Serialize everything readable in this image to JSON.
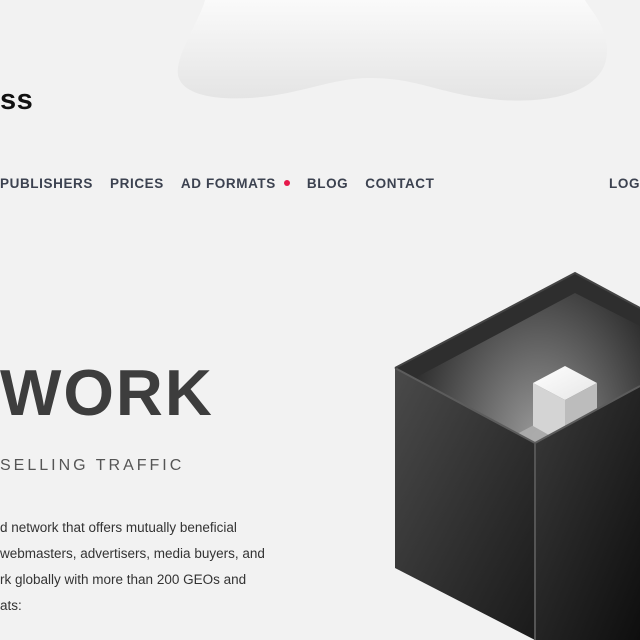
{
  "header": {
    "logo_text": "ss"
  },
  "nav": {
    "items": [
      {
        "label": "PUBLISHERS"
      },
      {
        "label": "PRICES"
      },
      {
        "label": "AD FORMATS",
        "has_dot": true
      },
      {
        "label": "BLOG"
      },
      {
        "label": "CONTACT"
      }
    ],
    "login_label": "LOG",
    "dot_color": "#e6194b"
  },
  "hero": {
    "title": "WORK",
    "subtitle": "SELLING TRAFFIC",
    "description_lines": [
      "d network that offers mutually beneficial",
      "webmasters, advertisers, media buyers, and",
      "rk globally with more than 200 GEOs and",
      "ats:"
    ]
  },
  "illustration": {
    "icon": "cube-icon"
  }
}
